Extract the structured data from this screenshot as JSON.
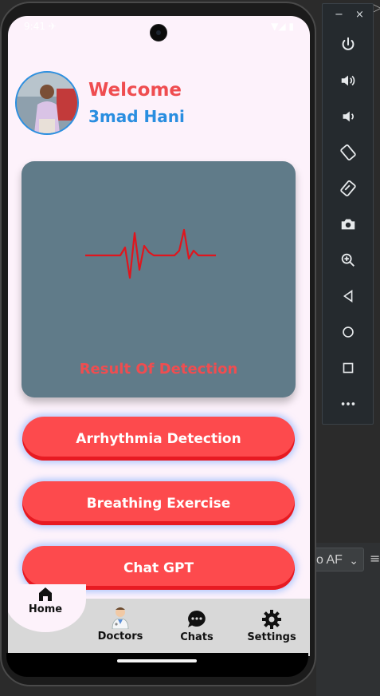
{
  "status_bar": {
    "left": "9:41 ✈",
    "right": "▼◢ ▮"
  },
  "header": {
    "welcome": "Welcome",
    "username": "3mad Hani"
  },
  "result_card": {
    "label": "Result Of Detection"
  },
  "actions": [
    {
      "label": "Arrhythmia Detection"
    },
    {
      "label": "Breathing Exercise"
    },
    {
      "label": "Chat GPT"
    }
  ],
  "nav": [
    {
      "label": "Home",
      "icon": "home-icon",
      "active": true
    },
    {
      "label": "Doctors",
      "icon": "doctor-icon",
      "active": false
    },
    {
      "label": "Chats",
      "icon": "chat-bubble-icon",
      "active": false
    },
    {
      "label": "Settings",
      "icon": "gear-icon",
      "active": false
    }
  ],
  "emulator_toolbar": {
    "window_controls": [
      "−",
      "×"
    ],
    "buttons": [
      "power-icon",
      "volume-up-icon",
      "volume-down-icon",
      "rotate-left-icon",
      "rotate-right-icon",
      "camera-icon",
      "zoom-icon",
      "back-icon",
      "home-circle-icon",
      "overview-square-icon",
      "more-icon"
    ]
  },
  "desktop": {
    "combo_text": "o AF",
    "menu_glyph": "≡",
    "play_glyph": "▷"
  },
  "colors": {
    "accent_red": "#fd4a4d",
    "accent_blue": "#2a8ee0",
    "card": "#607b89",
    "screen_bg": "#fdf2fb"
  }
}
